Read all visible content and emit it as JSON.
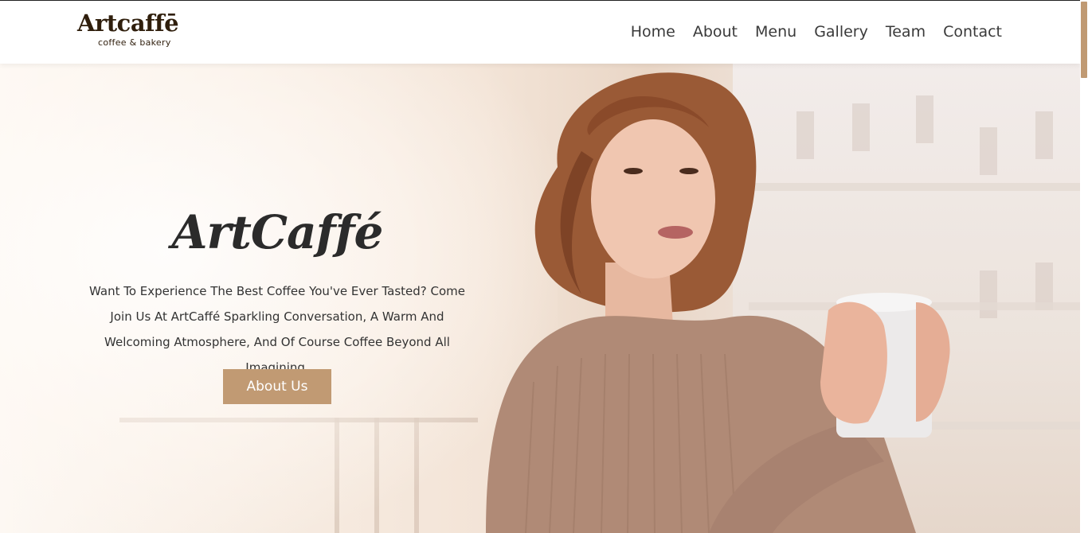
{
  "brand": {
    "name": "Artcaffē",
    "tagline": "coffee & bakery"
  },
  "nav": {
    "items": [
      "Home",
      "About",
      "Menu",
      "Gallery",
      "Team",
      "Contact"
    ]
  },
  "hero": {
    "title": "ArtCaffé",
    "description": "Want To Experience The Best Coffee You've Ever Tasted? Come Join Us At ArtCaffé Sparkling Conversation, A Warm And Welcoming Atmosphere, And Of Course Coffee Beyond All Imagining.",
    "button_label": "About Us",
    "image_icon": "woman-with-coffee-cup-photo"
  },
  "colors": {
    "accent": "#c19a73",
    "brand_text": "#2f1e0c",
    "nav_text": "#3a3a3a"
  }
}
